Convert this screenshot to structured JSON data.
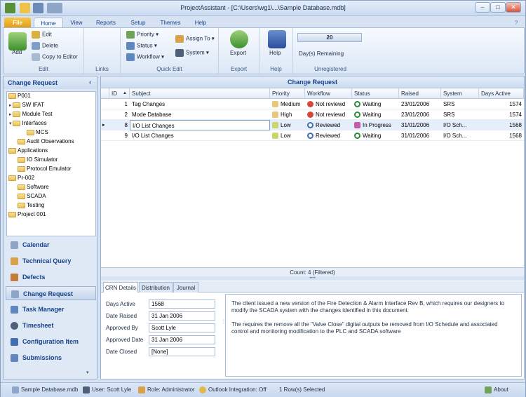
{
  "window": {
    "title": "ProjectAssistant - [C:\\Users\\wg1\\...\\Sample Database.mdb]"
  },
  "ribbon_tabs": [
    "File",
    "Home",
    "View",
    "Reports",
    "Setup",
    "Themes",
    "Help"
  ],
  "ribbon": {
    "edit": {
      "add": "Add",
      "edit": "Edit",
      "delete": "Delete",
      "copy": "Copy to Editor",
      "label": "Edit"
    },
    "links": {
      "label": "Links"
    },
    "quick": {
      "priority": "Priority",
      "status": "Status",
      "workflow": "Workflow",
      "assign": "Assign To",
      "system": "System",
      "label": "Quick Edit"
    },
    "export": {
      "btn": "Export",
      "label": "Export"
    },
    "help": {
      "btn": "Help",
      "label": "Help"
    },
    "unreg": {
      "days": "20",
      "days_label": "Day(s) Remaining",
      "label": "Unregistered"
    }
  },
  "nav": {
    "header": "Change Request",
    "tree": [
      "P001",
      "SW IFAT",
      "Module Test",
      "Interfaces",
      "MCS",
      "Audit Observations",
      "Applications",
      "IO Simulator",
      "Protocol Emulator",
      "Pr-002",
      "Software",
      "SCADA",
      "Testing",
      "Project 001"
    ],
    "buttons": [
      "Calendar",
      "Technical Query",
      "Defects",
      "Change Request",
      "Task Manager",
      "Timesheet",
      "Configuration Item",
      "Submissions"
    ]
  },
  "grid": {
    "header": "Change Request",
    "columns": [
      "ID",
      "Subject",
      "Priority",
      "Workflow",
      "Status",
      "Raised",
      "System",
      "Days Active"
    ],
    "rows": [
      {
        "id": "1",
        "subject": "Tag Changes",
        "priority": "Medium",
        "workflow": "Not reviewd",
        "status": "Waiting",
        "raised": "23/01/2006",
        "system": "SRS",
        "days": "1574"
      },
      {
        "id": "2",
        "subject": "Mode Database",
        "priority": "High",
        "workflow": "Not reviewd",
        "status": "Waiting",
        "raised": "23/01/2006",
        "system": "SRS",
        "days": "1574"
      },
      {
        "id": "8",
        "subject": "I/O List Changes",
        "priority": "Low",
        "workflow": "Reviewed",
        "status": "In Progress",
        "raised": "31/01/2006",
        "system": "I/O Sch...",
        "days": "1568"
      },
      {
        "id": "9",
        "subject": "I/O List Changes",
        "priority": "Low",
        "workflow": "Reviewed",
        "status": "Waiting",
        "raised": "31/01/2006",
        "system": "I/O Sch...",
        "days": "1568"
      }
    ],
    "count": "Count: 4 (Filtered)"
  },
  "detail_tabs": [
    "CRN Details",
    "Distribution",
    "Journal"
  ],
  "details": {
    "days_active_label": "Days Active",
    "days_active": "1568",
    "date_raised_label": "Date Raised",
    "date_raised": "31 Jan 2006",
    "approved_by_label": "Approved By",
    "approved_by": "Scott Lyle",
    "approved_date_label": "Approved Date",
    "approved_date": "31 Jan 2006",
    "date_closed_label": "Date Closed",
    "date_closed": "[None]",
    "notes_p1": "The client issued a new version of the Fire Detection & Alarm Interface Rev B, which requires our designers to modify the SCADA system with the changes identified in this document.",
    "notes_p2": "The requires the remove all the \"Valve Close\" digital outputs be removed from I/O Schedule and associated control and monitoring modification to the PLC and SCADA software"
  },
  "status": {
    "db": "Sample Database.mdb",
    "user": "User: Scott Lyle",
    "role": "Role: Administrator",
    "outlook": "Outlook Integration: Off",
    "rows": "1 Row(s) Selected",
    "about": "About"
  },
  "colors": {
    "accent": "#15428b",
    "file_tab": "#e39b17",
    "selected_row": "#e5eefb"
  }
}
